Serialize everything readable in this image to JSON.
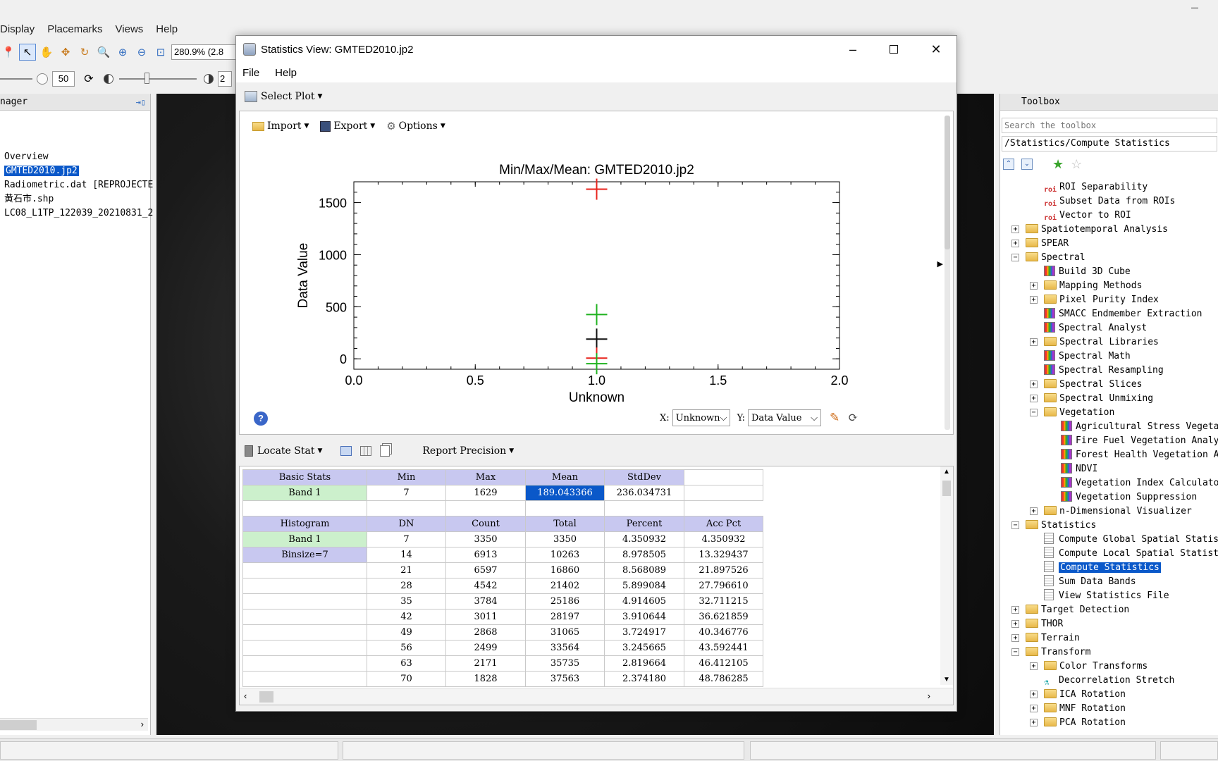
{
  "main": {
    "menu": [
      "Display",
      "Placemarks",
      "Views",
      "Help"
    ],
    "zoom": "280.9% (2.8",
    "stretch_value": "50",
    "stretch_value2": "2"
  },
  "layer_manager": {
    "title": "nager",
    "items": [
      {
        "label": "Overview",
        "selected": false
      },
      {
        "label": "GMTED2010.jp2",
        "selected": true
      },
      {
        "label": "Radiometric.dat [REPROJECTE",
        "selected": false
      },
      {
        "label": "黄石市.shp",
        "selected": false
      },
      {
        "label": "LC08_L1TP_122039_20210831_2",
        "selected": false
      }
    ]
  },
  "dialog": {
    "title": "Statistics View: GMTED2010.jp2",
    "menu": [
      "File",
      "Help"
    ],
    "select_plot": "Select Plot",
    "plot_toolbar": {
      "import": "Import",
      "export": "Export",
      "options": "Options"
    },
    "x_label_prefix": "X:",
    "x_value": "Unknown",
    "y_label_prefix": "Y:",
    "y_value": "Data Value",
    "locate_stat": "Locate Stat",
    "report_precision": "Report Precision"
  },
  "chart_data": {
    "type": "scatter",
    "title": "Min/Max/Mean: GMTED2010.jp2",
    "xlabel": "Unknown",
    "ylabel": "Data Value",
    "xlim": [
      0.0,
      2.0
    ],
    "ylim": [
      -100,
      1700
    ],
    "xticks": [
      "0.0",
      "0.5",
      "1.0",
      "1.5",
      "2.0"
    ],
    "yticks": [
      {
        "v": 0,
        "t": "0"
      },
      {
        "v": 500,
        "t": "500"
      },
      {
        "v": 1000,
        "t": "1000"
      },
      {
        "v": 1500,
        "t": "1500"
      }
    ],
    "points": [
      {
        "x": 1.0,
        "y": 1629,
        "color": "#e8231c"
      },
      {
        "x": 1.0,
        "y": 425,
        "color": "#1fb21f"
      },
      {
        "x": 1.0,
        "y": 189,
        "color": "#111111"
      },
      {
        "x": 1.0,
        "y": 7,
        "color": "#e8231c"
      },
      {
        "x": 1.0,
        "y": -47,
        "color": "#1fb21f"
      }
    ]
  },
  "basic_stats": {
    "headers": [
      "Basic Stats",
      "Min",
      "Max",
      "Mean",
      "StdDev"
    ],
    "row": [
      "Band 1",
      "7",
      "1629",
      "189.043366",
      "236.034731"
    ]
  },
  "histogram": {
    "headers": [
      "Histogram",
      "DN",
      "Count",
      "Total",
      "Percent",
      "Acc Pct"
    ],
    "labels": [
      "Band 1",
      "Binsize=7"
    ],
    "rows": [
      [
        "7",
        "3350",
        "3350",
        "4.350932",
        "4.350932"
      ],
      [
        "14",
        "6913",
        "10263",
        "8.978505",
        "13.329437"
      ],
      [
        "21",
        "6597",
        "16860",
        "8.568089",
        "21.897526"
      ],
      [
        "28",
        "4542",
        "21402",
        "5.899084",
        "27.796610"
      ],
      [
        "35",
        "3784",
        "25186",
        "4.914605",
        "32.711215"
      ],
      [
        "42",
        "3011",
        "28197",
        "3.910644",
        "36.621859"
      ],
      [
        "49",
        "2868",
        "31065",
        "3.724917",
        "40.346776"
      ],
      [
        "56",
        "2499",
        "33564",
        "3.245665",
        "43.592441"
      ],
      [
        "63",
        "2171",
        "35735",
        "2.819664",
        "46.412105"
      ],
      [
        "70",
        "1828",
        "37563",
        "2.374180",
        "48.786285"
      ]
    ]
  },
  "toolbox": {
    "title": "Toolbox",
    "search_placeholder": "Search the toolbox",
    "path": "/Statistics/Compute Statistics",
    "items": [
      {
        "label": "ROI Separability",
        "level": 2,
        "icon": "roi"
      },
      {
        "label": "Subset Data from ROIs",
        "level": 2,
        "icon": "roi"
      },
      {
        "label": "Vector to ROI",
        "level": 2,
        "icon": "roi"
      },
      {
        "label": "Spatiotemporal Analysis",
        "level": 1,
        "icon": "folder",
        "expander": "+"
      },
      {
        "label": "SPEAR",
        "level": 1,
        "icon": "folder",
        "expander": "+"
      },
      {
        "label": "Spectral",
        "level": 1,
        "icon": "folder",
        "expander": "-"
      },
      {
        "label": "Build 3D Cube",
        "level": 2,
        "icon": "tool"
      },
      {
        "label": "Mapping Methods",
        "level": 2,
        "icon": "folder",
        "expander": "+"
      },
      {
        "label": "Pixel Purity Index",
        "level": 2,
        "icon": "folder",
        "expander": "+"
      },
      {
        "label": "SMACC Endmember Extraction",
        "level": 2,
        "icon": "tool"
      },
      {
        "label": "Spectral Analyst",
        "level": 2,
        "icon": "tool"
      },
      {
        "label": "Spectral Libraries",
        "level": 2,
        "icon": "folder",
        "expander": "+"
      },
      {
        "label": "Spectral Math",
        "level": 2,
        "icon": "tool"
      },
      {
        "label": "Spectral Resampling",
        "level": 2,
        "icon": "tool"
      },
      {
        "label": "Spectral Slices",
        "level": 2,
        "icon": "folder",
        "expander": "+"
      },
      {
        "label": "Spectral Unmixing",
        "level": 2,
        "icon": "folder",
        "expander": "+"
      },
      {
        "label": "Vegetation",
        "level": 2,
        "icon": "folder",
        "expander": "-"
      },
      {
        "label": "Agricultural Stress Vegetati",
        "level": 3,
        "icon": "tool"
      },
      {
        "label": "Fire Fuel Vegetation Analysi",
        "level": 3,
        "icon": "tool"
      },
      {
        "label": "Forest Health Vegetation Ana",
        "level": 3,
        "icon": "tool"
      },
      {
        "label": "NDVI",
        "level": 3,
        "icon": "tool"
      },
      {
        "label": "Vegetation Index Calculator",
        "level": 3,
        "icon": "tool"
      },
      {
        "label": "Vegetation Suppression",
        "level": 3,
        "icon": "tool"
      },
      {
        "label": "n-Dimensional Visualizer",
        "level": 2,
        "icon": "folder",
        "expander": "+"
      },
      {
        "label": "Statistics",
        "level": 1,
        "icon": "folder",
        "expander": "-"
      },
      {
        "label": "Compute Global Spatial Statisti",
        "level": 2,
        "icon": "doc"
      },
      {
        "label": "Compute Local Spatial Statistic",
        "level": 2,
        "icon": "doc"
      },
      {
        "label": "Compute Statistics",
        "level": 2,
        "icon": "doc",
        "selected": true
      },
      {
        "label": "Sum Data Bands",
        "level": 2,
        "icon": "doc"
      },
      {
        "label": "View Statistics File",
        "level": 2,
        "icon": "doc"
      },
      {
        "label": "Target Detection",
        "level": 1,
        "icon": "folder",
        "expander": "+"
      },
      {
        "label": "THOR",
        "level": 1,
        "icon": "folder",
        "expander": "+"
      },
      {
        "label": "Terrain",
        "level": 1,
        "icon": "folder",
        "expander": "+"
      },
      {
        "label": "Transform",
        "level": 1,
        "icon": "folder",
        "expander": "-"
      },
      {
        "label": "Color Transforms",
        "level": 2,
        "icon": "folder",
        "expander": "+"
      },
      {
        "label": "Decorrelation Stretch",
        "level": 2,
        "icon": "flask"
      },
      {
        "label": "ICA Rotation",
        "level": 2,
        "icon": "folder",
        "expander": "+"
      },
      {
        "label": "MNF Rotation",
        "level": 2,
        "icon": "folder",
        "expander": "+"
      },
      {
        "label": "PCA Rotation",
        "level": 2,
        "icon": "folder",
        "expander": "+"
      }
    ]
  }
}
